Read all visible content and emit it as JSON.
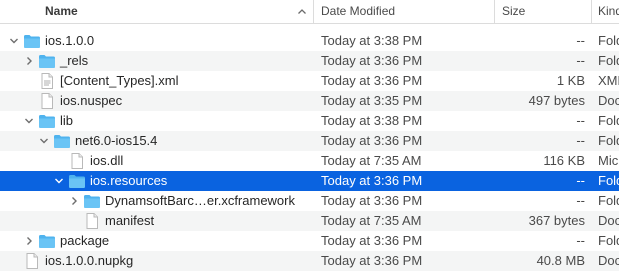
{
  "header": {
    "name": "Name",
    "date": "Date Modified",
    "size": "Size",
    "kind": "Kind",
    "sort_icon": "chevron-up"
  },
  "colors": {
    "selection": "#0a63e0",
    "folder": "#4fb3ee"
  },
  "rows": [
    {
      "name": "ios.1.0.0",
      "date": "Today at 3:38 PM",
      "size": "--",
      "kind": "Fold",
      "icon": "folder-icon",
      "disclosure": "expanded"
    },
    {
      "name": "_rels",
      "date": "Today at 3:36 PM",
      "size": "--",
      "kind": "Fold",
      "icon": "folder-icon",
      "disclosure": "collapsed"
    },
    {
      "name": "[Content_Types].xml",
      "date": "Today at 3:36 PM",
      "size": "1 KB",
      "kind": "XML",
      "icon": "xml-file-icon",
      "disclosure": "none"
    },
    {
      "name": "ios.nuspec",
      "date": "Today at 3:35 PM",
      "size": "497 bytes",
      "kind": "Doc",
      "icon": "document-icon",
      "disclosure": "none"
    },
    {
      "name": "lib",
      "date": "Today at 3:38 PM",
      "size": "--",
      "kind": "Fold",
      "icon": "folder-icon",
      "disclosure": "expanded"
    },
    {
      "name": "net6.0-ios15.4",
      "date": "Today at 3:36 PM",
      "size": "--",
      "kind": "Fold",
      "icon": "folder-icon",
      "disclosure": "expanded"
    },
    {
      "name": "ios.dll",
      "date": "Today at 7:35 AM",
      "size": "116 KB",
      "kind": "Micr",
      "icon": "document-icon",
      "disclosure": "none"
    },
    {
      "name": "ios.resources",
      "date": "Today at 3:36 PM",
      "size": "--",
      "kind": "Fold",
      "icon": "folder-icon",
      "disclosure": "expanded",
      "selected": true
    },
    {
      "name": "DynamsoftBarc…er.xcframework",
      "date": "Today at 3:36 PM",
      "size": "--",
      "kind": "Fold",
      "icon": "folder-icon",
      "disclosure": "collapsed"
    },
    {
      "name": "manifest",
      "date": "Today at 7:35 AM",
      "size": "367 bytes",
      "kind": "Doc",
      "icon": "document-icon",
      "disclosure": "none"
    },
    {
      "name": "package",
      "date": "Today at 3:36 PM",
      "size": "--",
      "kind": "Fold",
      "icon": "folder-icon",
      "disclosure": "collapsed"
    },
    {
      "name": "ios.1.0.0.nupkg",
      "date": "Today at 3:36 PM",
      "size": "40.8 MB",
      "kind": "Doc",
      "icon": "document-icon",
      "disclosure": "none"
    }
  ]
}
